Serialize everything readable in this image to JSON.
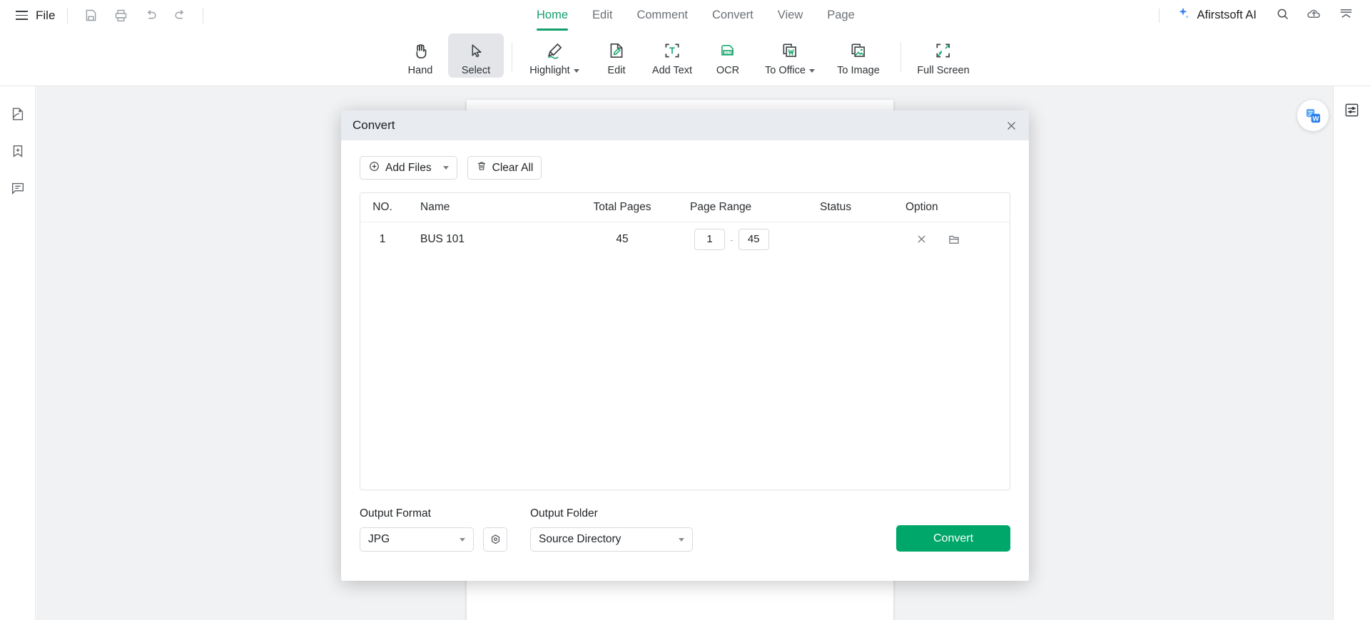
{
  "app": {
    "file_menu": "File",
    "accent_green": "#13a06a",
    "convert_green": "#00a76a"
  },
  "topbar": {
    "quick_icons": [
      "save-icon",
      "print-icon",
      "undo-icon",
      "redo-icon"
    ],
    "tabs": [
      {
        "label": "Home",
        "active": true
      },
      {
        "label": "Edit",
        "active": false
      },
      {
        "label": "Comment",
        "active": false
      },
      {
        "label": "Convert",
        "active": false
      },
      {
        "label": "View",
        "active": false
      },
      {
        "label": "Page",
        "active": false
      }
    ],
    "ai_label": "Afirstsoft AI",
    "ai_icon": "sparkle-icon",
    "search_icon": "search-icon",
    "right_icons": [
      "cloud-upload-icon",
      "collapse-ribbon-icon"
    ]
  },
  "ribbon": {
    "items": [
      {
        "label": "Hand",
        "icon": "hand-icon",
        "active": false,
        "caret": false
      },
      {
        "label": "Select",
        "icon": "cursor-arrow-icon",
        "active": true,
        "caret": false
      },
      {
        "label": "Highlight",
        "icon": "highlighter-pen-icon",
        "active": false,
        "caret": true
      },
      {
        "label": "Edit",
        "icon": "edit-document-icon",
        "active": false,
        "caret": false
      },
      {
        "label": "Add Text",
        "icon": "add-text-icon",
        "active": false,
        "caret": false
      },
      {
        "label": "OCR",
        "icon": "ocr-icon",
        "active": false,
        "caret": false
      },
      {
        "label": "To Office",
        "icon": "to-office-word-icon",
        "active": false,
        "caret": true
      },
      {
        "label": "To Image",
        "icon": "to-image-icon",
        "active": false,
        "caret": false
      },
      {
        "label": "Full Screen",
        "icon": "full-screen-icon",
        "active": false,
        "caret": false
      }
    ]
  },
  "sidebar": {
    "items": [
      {
        "icon": "page-thumbnail-icon"
      },
      {
        "icon": "bookmark-add-icon"
      },
      {
        "icon": "comment-icon"
      }
    ]
  },
  "right_panel": {
    "items": [
      {
        "icon": "properties-sliders-icon"
      }
    ],
    "float_button": "word-translate-icon"
  },
  "modal": {
    "title": "Convert",
    "close_icon": "close-icon",
    "add_files_label": "Add Files",
    "add_files_icon": "plus-circle-icon",
    "clear_all_label": "Clear All",
    "clear_all_icon": "trash-icon",
    "table": {
      "columns": [
        "NO.",
        "Name",
        "Total Pages",
        "Page Range",
        "Status",
        "Option"
      ],
      "rows": [
        {
          "no": "1",
          "name": "BUS 101",
          "total_pages": "45",
          "range_from": "1",
          "range_to": "45",
          "range_separator": "-",
          "status": "",
          "option_icons": [
            "remove-file-icon",
            "open-folder-icon"
          ]
        }
      ]
    },
    "output_format_label": "Output Format",
    "output_format_value": "JPG",
    "format_settings_icon": "settings-hex-icon",
    "output_folder_label": "Output Folder",
    "output_folder_value": "Source Directory",
    "convert_label": "Convert"
  }
}
